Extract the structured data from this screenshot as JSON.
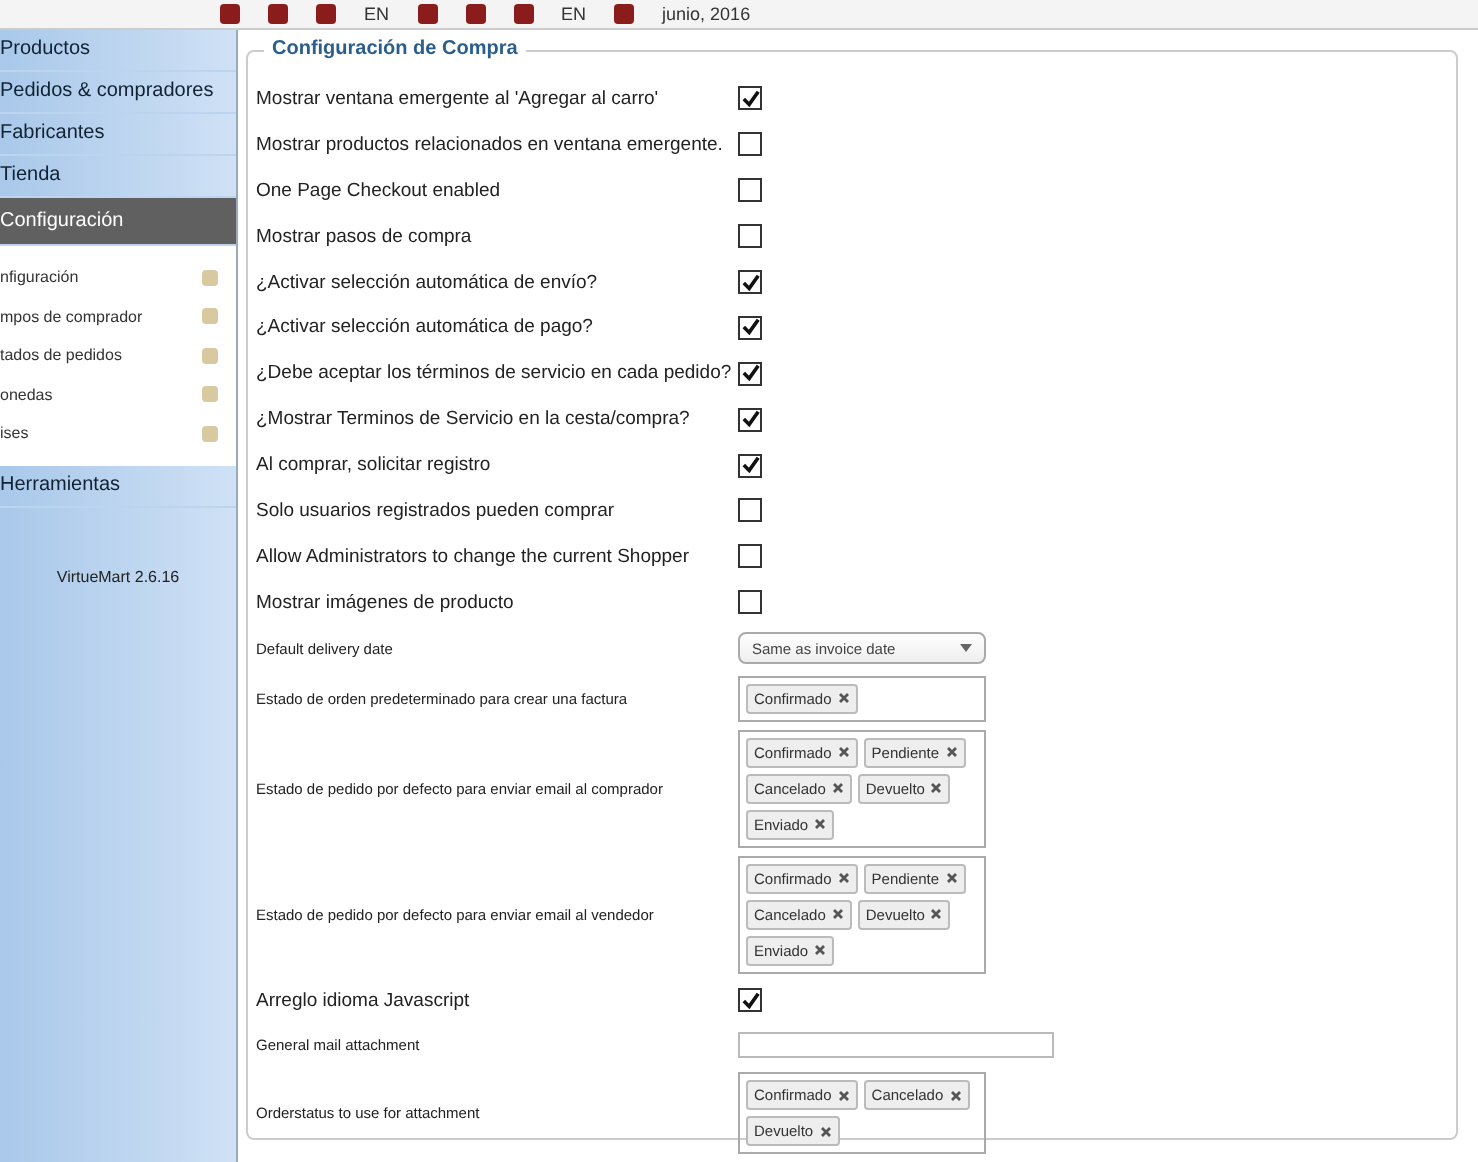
{
  "toolbar": {
    "items": [
      {
        "kind": "icon"
      },
      {
        "kind": "icon"
      },
      {
        "kind": "icon"
      },
      {
        "kind": "text",
        "label": "EN"
      },
      {
        "kind": "icon"
      },
      {
        "kind": "icon"
      },
      {
        "kind": "icon"
      },
      {
        "kind": "text",
        "label": "EN"
      },
      {
        "kind": "icon"
      },
      {
        "kind": "text",
        "label": "junio, 2016"
      }
    ]
  },
  "sidebar": {
    "items": [
      {
        "label": "Productos",
        "selected": false
      },
      {
        "label": "Pedidos & compradores",
        "selected": false
      },
      {
        "label": "Fabricantes",
        "selected": false
      },
      {
        "label": "Tienda",
        "selected": false
      },
      {
        "label": "Configuración",
        "selected": true,
        "children": [
          {
            "label": "nfiguración"
          },
          {
            "label": "mpos de comprador"
          },
          {
            "label": "tados de pedidos"
          },
          {
            "label": "onedas"
          },
          {
            "label": "ises"
          }
        ]
      },
      {
        "label": "Herramientas",
        "selected": false
      }
    ],
    "version": "VirtueMart 2.6.16"
  },
  "fieldset": {
    "legend": "Configuración de Compra",
    "rows": [
      {
        "kind": "checkbox",
        "label": "Mostrar ventana emergente al 'Agregar al carro'",
        "checked": true
      },
      {
        "kind": "checkbox",
        "label": "Mostrar productos relacionados en ventana emergente.",
        "checked": false
      },
      {
        "kind": "checkbox",
        "label": "One Page Checkout enabled",
        "checked": false
      },
      {
        "kind": "checkbox",
        "label": "Mostrar pasos de compra",
        "checked": false
      },
      {
        "kind": "checkbox",
        "label": "¿Activar selección automática de envío?",
        "checked": true
      },
      {
        "kind": "checkbox",
        "label": "¿Activar selección automática de pago?",
        "checked": true
      },
      {
        "kind": "checkbox",
        "label": "¿Debe aceptar los términos de servicio en cada pedido?",
        "checked": true
      },
      {
        "kind": "checkbox",
        "label": "¿Mostrar Terminos de Servicio en la cesta/compra?",
        "checked": true
      },
      {
        "kind": "checkbox",
        "label": "Al comprar, solicitar registro",
        "checked": true
      },
      {
        "kind": "checkbox",
        "label": "Solo usuarios registrados pueden comprar",
        "checked": false
      },
      {
        "kind": "checkbox",
        "label": "Allow Administrators to change the current Shopper",
        "checked": false
      },
      {
        "kind": "checkbox",
        "label": "Mostrar imágenes de producto",
        "checked": false
      },
      {
        "kind": "select",
        "label": "Default delivery date",
        "value": "Same as invoice date"
      },
      {
        "kind": "tags",
        "label": "Estado de orden predeterminado para crear una factura",
        "tags": [
          "Confirmado"
        ]
      },
      {
        "kind": "tags",
        "label": "Estado de pedido por defecto para enviar email al comprador",
        "tags": [
          "Confirmado",
          "Pendiente",
          "Cancelado",
          "Devuelto",
          "Enviado"
        ]
      },
      {
        "kind": "tags",
        "label": "Estado de pedido por defecto para enviar email al vendedor",
        "tags": [
          "Confirmado",
          "Pendiente",
          "Cancelado",
          "Devuelto",
          "Enviado"
        ]
      },
      {
        "kind": "checkbox",
        "label": "Arreglo idioma Javascript",
        "checked": true
      },
      {
        "kind": "text",
        "label": "General mail attachment"
      },
      {
        "kind": "tags",
        "label": "Orderstatus to use for attachment",
        "tags": [
          "Confirmado",
          "Cancelado",
          "Devuelto"
        ]
      }
    ]
  }
}
